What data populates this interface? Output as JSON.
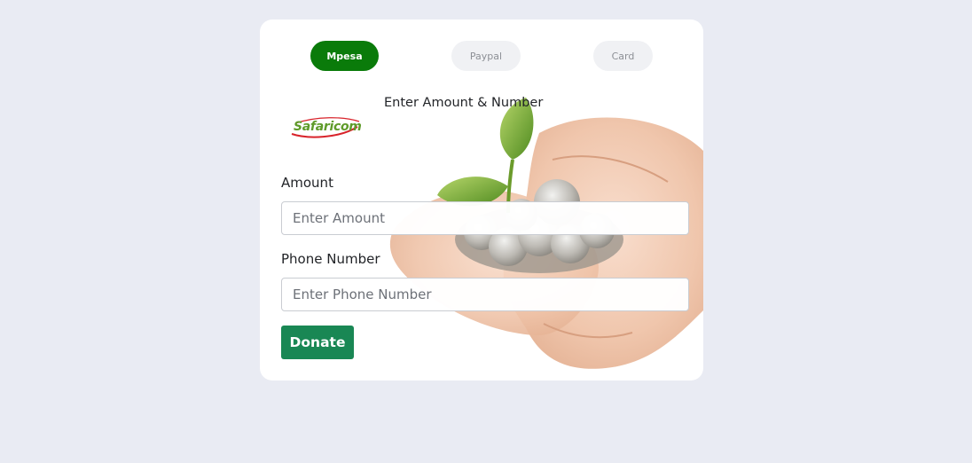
{
  "payment_tabs": [
    {
      "label": "Mpesa",
      "active": true
    },
    {
      "label": "Paypal",
      "active": false
    },
    {
      "label": "Card",
      "active": false
    }
  ],
  "form": {
    "title": "Enter Amount & Number",
    "logo_text": "Safaricom",
    "amount_label": "Amount",
    "amount_placeholder": "Enter Amount",
    "amount_value": "",
    "phone_label": "Phone Number",
    "phone_placeholder": "Enter Phone Number",
    "phone_value": "",
    "submit_label": "Donate"
  },
  "colors": {
    "page_background": "#e9ebf3",
    "active_tab": "#0a7b0a",
    "inactive_tab": "#f0f1f4",
    "submit_button": "#198754"
  },
  "icons": {
    "illustration": "hands-holding-coins-with-plant-image",
    "logo": "safaricom-logo"
  }
}
